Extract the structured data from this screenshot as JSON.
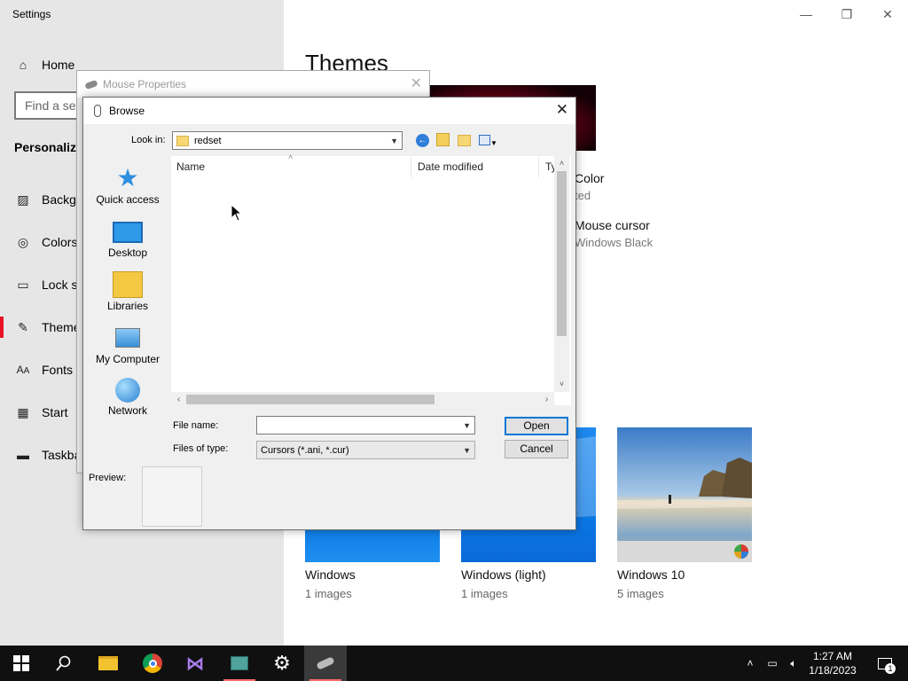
{
  "settings": {
    "title": "Settings",
    "home": "Home",
    "search_placeholder": "Find a setting",
    "section": "Personalization",
    "nav": [
      {
        "label": "Background",
        "icon": "image-icon"
      },
      {
        "label": "Colors",
        "icon": "palette-icon"
      },
      {
        "label": "Lock screen",
        "icon": "lock-screen-icon"
      },
      {
        "label": "Themes",
        "icon": "themes-icon"
      },
      {
        "label": "Fonts",
        "icon": "fonts-icon"
      },
      {
        "label": "Start",
        "icon": "start-icon"
      },
      {
        "label": "Taskbar",
        "icon": "taskbar-icon"
      }
    ],
    "active_nav": "Themes",
    "accent_color": "#e81123"
  },
  "themes": {
    "heading": "Themes",
    "color_label": "Color",
    "color_value": "ted",
    "cursor_label": "Mouse cursor",
    "cursor_value": "Windows Black",
    "tiles": [
      {
        "name": "Windows",
        "count": "1 images"
      },
      {
        "name": "Windows (light)",
        "count": "1 images"
      },
      {
        "name": "Windows 10",
        "count": "5 images"
      }
    ]
  },
  "mouse_properties": {
    "title": "Mouse Properties"
  },
  "browse": {
    "title": "Browse",
    "look_in_label": "Look in:",
    "look_in_value": "redset",
    "places": [
      "Quick access",
      "Desktop",
      "Libraries",
      "My Computer",
      "Network"
    ],
    "columns": [
      "Name",
      "Date modified",
      "Ty"
    ],
    "file_name_label": "File name:",
    "file_name_value": "",
    "files_of_type_label": "Files of type:",
    "files_of_type_value": "Cursors (*.ani, *.cur)",
    "open_label": "Open",
    "cancel_label": "Cancel",
    "preview_label": "Preview:"
  },
  "taskbar": {
    "time": "1:27 AM",
    "date": "1/18/2023",
    "notification_count": "1"
  }
}
